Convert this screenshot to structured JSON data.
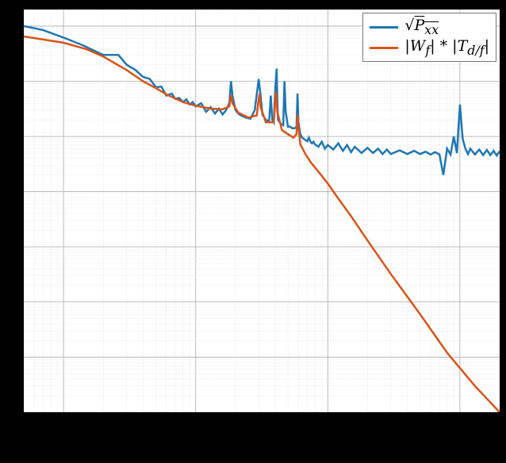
{
  "chart_data": {
    "type": "line",
    "xscale": "log",
    "yscale": "log",
    "title": "",
    "xlabel": "",
    "ylabel": "",
    "xlim": [
      0.5,
      2000
    ],
    "ylim": [
      1e-07,
      2
    ],
    "x_major_ticks": [
      1,
      10,
      100,
      1000
    ],
    "y_major_ticks": [
      1e-07,
      1e-06,
      1e-05,
      0.0001,
      0.001,
      0.01,
      0.1,
      1,
      10
    ],
    "grid": {
      "major": true,
      "minor": true
    },
    "legend": {
      "position": "upper right",
      "entries": [
        "√Pₓₓ",
        "|W_f| * |T_{d/f}|"
      ]
    },
    "colors": {
      "pxx": "#1f77b4",
      "wf": "#d95319"
    },
    "series": [
      {
        "name": "sqrt(Pxx)",
        "color": "#1f77b4",
        "x": [
          0.5,
          0.7,
          1,
          1.4,
          2,
          2.6,
          3,
          3.5,
          4,
          4.5,
          5,
          5.5,
          6,
          6.6,
          7,
          7.5,
          8,
          8.5,
          9,
          9.5,
          10,
          11,
          12,
          13,
          14,
          15,
          16,
          17,
          18,
          18.5,
          19,
          20,
          21,
          22,
          24,
          26,
          28,
          30,
          31,
          32,
          34,
          36,
          37,
          38,
          39,
          40,
          41,
          41.5,
          42,
          44,
          46,
          47,
          48,
          50,
          52,
          54,
          56,
          58,
          59,
          60,
          62,
          64,
          66,
          68,
          70,
          72,
          74,
          76,
          78,
          80,
          85,
          90,
          95,
          100,
          110,
          120,
          130,
          140,
          150,
          160,
          180,
          200,
          220,
          240,
          260,
          280,
          300,
          350,
          400,
          450,
          500,
          550,
          600,
          650,
          700,
          750,
          800,
          850,
          900,
          950,
          1000,
          1050,
          1100,
          1150,
          1200,
          1300,
          1400,
          1500,
          1600,
          1700,
          1800,
          1900,
          2000
        ],
        "y": [
          1.0,
          0.85,
          0.62,
          0.45,
          0.3,
          0.3,
          0.2,
          0.16,
          0.12,
          0.11,
          0.078,
          0.08,
          0.055,
          0.06,
          0.048,
          0.05,
          0.042,
          0.047,
          0.038,
          0.042,
          0.035,
          0.04,
          0.028,
          0.034,
          0.026,
          0.032,
          0.025,
          0.03,
          0.04,
          0.1,
          0.055,
          0.03,
          0.026,
          0.024,
          0.022,
          0.021,
          0.03,
          0.11,
          0.055,
          0.025,
          0.02,
          0.019,
          0.055,
          0.02,
          0.018,
          0.07,
          0.17,
          0.045,
          0.02,
          0.017,
          0.016,
          0.1,
          0.028,
          0.015,
          0.015,
          0.014,
          0.014,
          0.015,
          0.06,
          0.018,
          0.011,
          0.0095,
          0.009,
          0.0085,
          0.0082,
          0.0095,
          0.008,
          0.0075,
          0.008,
          0.0072,
          0.0065,
          0.008,
          0.006,
          0.007,
          0.0058,
          0.0075,
          0.0055,
          0.007,
          0.0052,
          0.0065,
          0.005,
          0.0062,
          0.005,
          0.006,
          0.0048,
          0.0058,
          0.0048,
          0.0056,
          0.0048,
          0.0055,
          0.0048,
          0.0053,
          0.0047,
          0.0052,
          0.0047,
          0.002,
          0.006,
          0.0047,
          0.01,
          0.005,
          0.038,
          0.009,
          0.006,
          0.0048,
          0.006,
          0.0047,
          0.0058,
          0.0046,
          0.0057,
          0.0046,
          0.0055,
          0.0045,
          0.0054,
          0.0045
        ]
      },
      {
        "name": "|W_f|*|T_{d/f}|",
        "color": "#d95319",
        "x": [
          0.5,
          1,
          1.5,
          2,
          3,
          4,
          5,
          6,
          8,
          10,
          13,
          16,
          18,
          18.5,
          19,
          21,
          25,
          29,
          30,
          30.5,
          31,
          34,
          39,
          40,
          40.5,
          41.5,
          45,
          55,
          58,
          59,
          60,
          62,
          68,
          75,
          85,
          100,
          120,
          150,
          200,
          300,
          500,
          800,
          1300,
          2000
        ],
        "y": [
          0.65,
          0.5,
          0.38,
          0.28,
          0.16,
          0.1,
          0.075,
          0.058,
          0.042,
          0.036,
          0.032,
          0.031,
          0.035,
          0.057,
          0.04,
          0.027,
          0.022,
          0.024,
          0.048,
          0.06,
          0.034,
          0.018,
          0.018,
          0.042,
          0.065,
          0.028,
          0.013,
          0.0095,
          0.011,
          0.025,
          0.015,
          0.0072,
          0.0047,
          0.0033,
          0.0023,
          0.0014,
          0.00075,
          0.00036,
          0.00013,
          3.2e-05,
          6e-06,
          1.2e-06,
          3e-07,
          1e-07
        ]
      }
    ]
  },
  "legend_labels": {
    "pxx_html": "√<span class=\"sqrt-sym\"><i>P<sub>xx</sub></i></span>",
    "wf_html": "|<i>W<sub>f</sub></i>|&nbsp;*&nbsp;|<i>T<sub>d/f</sub></i>|"
  }
}
